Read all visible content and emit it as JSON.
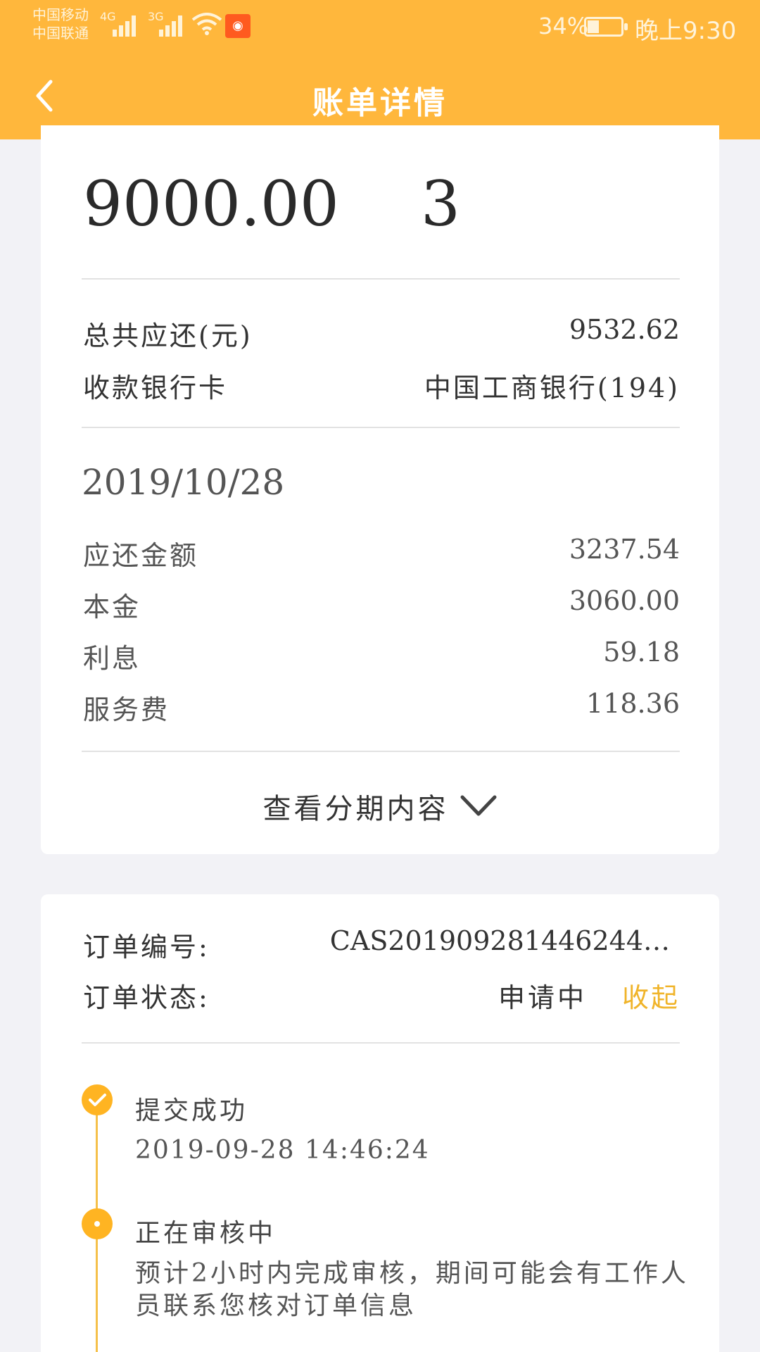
{
  "status_bar": {
    "carrier_1": "中国移动",
    "carrier_2": "中国联通",
    "network_1": "4G",
    "network_2": "3G",
    "battery_percent": "34%",
    "battery_level": 0.34,
    "time": "晚上9:30",
    "icons": [
      "signal-icon",
      "wifi-icon",
      "app-notification-icon",
      "battery-icon"
    ]
  },
  "header": {
    "title": "账单详情",
    "back_icon": "chevron-left-icon"
  },
  "summary": {
    "amount": "9000.00",
    "installments": "3",
    "total_due_label": "总共应还(元)",
    "total_due_value": "9532.62",
    "bank_card_label": "收款银行卡",
    "bank_card_value": "中国工商银行(194)"
  },
  "installment": {
    "date": "2019/10/28",
    "rows": [
      {
        "label": "应还金额",
        "value": "3237.54"
      },
      {
        "label": "本金",
        "value": "3060.00"
      },
      {
        "label": "利息",
        "value": "59.18"
      },
      {
        "label": "服务费",
        "value": "118.36"
      }
    ],
    "expand_label": "查看分期内容"
  },
  "order": {
    "number_label": "订单编号:",
    "number_value": "CAS201909281446244…",
    "status_label": "订单状态:",
    "status_value": "申请中",
    "toggle_label": "收起"
  },
  "timeline": [
    {
      "title": "提交成功",
      "subtitle": "2019-09-28 14:46:24",
      "state": "done"
    },
    {
      "title": "正在审核中",
      "subtitle": "预计2小时内完成审核，期间可能会有工作人员联系您核对订单信息",
      "state": "current"
    }
  ],
  "colors": {
    "brand": "#ffb73c",
    "accent_text": "#f0b42a",
    "timeline": "#ffb422"
  }
}
